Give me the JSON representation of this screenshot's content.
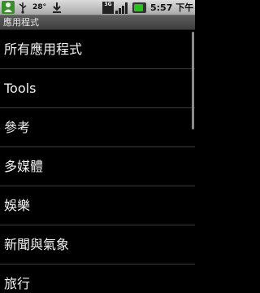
{
  "status_bar": {
    "temperature": "28°",
    "network_label": "3G",
    "time": "5:57 下午",
    "battery_level": 0.85,
    "icons": [
      "notification-icon",
      "usb-icon",
      "download-icon",
      "network-3g-icon",
      "signal-icon",
      "battery-icon"
    ]
  },
  "title_bar": {
    "title": "應用程式"
  },
  "list": {
    "items": [
      {
        "label": "所有應用程式"
      },
      {
        "label": "Tools"
      },
      {
        "label": "參考"
      },
      {
        "label": "多媒體"
      },
      {
        "label": "娛樂"
      },
      {
        "label": "新聞與氣象"
      },
      {
        "label": "旅行"
      }
    ]
  },
  "colors": {
    "background": "#000000",
    "text": "#f2f2f2",
    "battery": "#27c21b"
  }
}
